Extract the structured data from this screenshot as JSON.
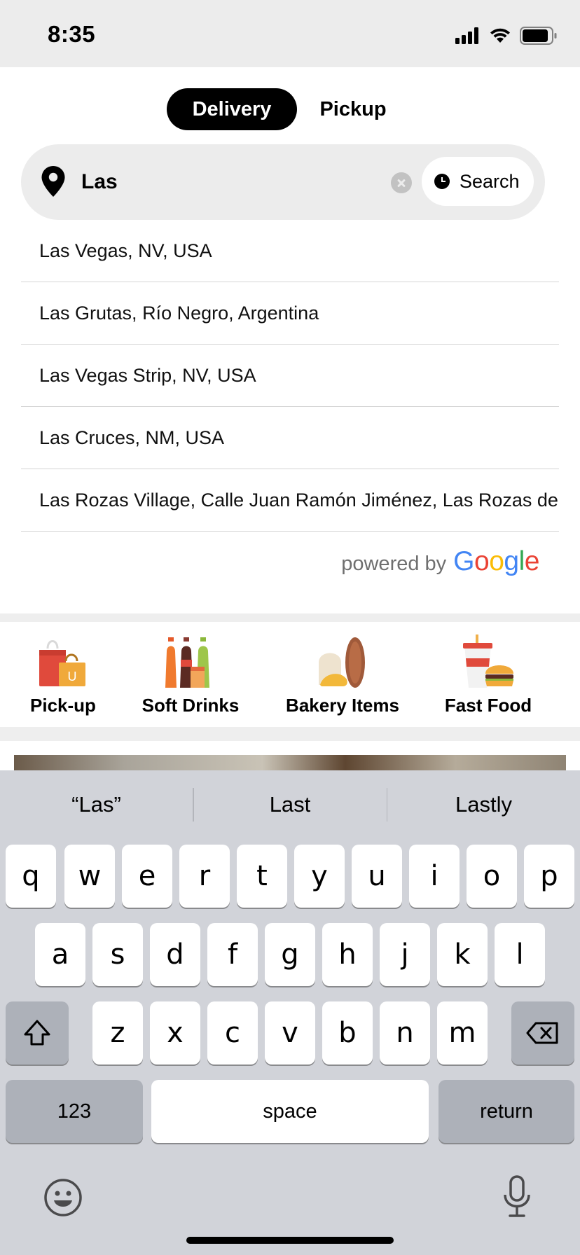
{
  "status_bar": {
    "time": "8:35",
    "icons": [
      "signal-icon",
      "wifi-icon",
      "battery-icon"
    ]
  },
  "mode_toggle": {
    "delivery_label": "Delivery",
    "pickup_label": "Pickup",
    "selected": "Delivery"
  },
  "search": {
    "value": "Las",
    "button_label": "Search",
    "icons": [
      "location-pin-icon",
      "clear-icon",
      "clock-icon"
    ]
  },
  "suggestions": [
    "Las Vegas, NV, USA",
    "Las Grutas, Río Negro, Argentina",
    "Las Vegas Strip, NV, USA",
    "Las Cruces, NM, USA",
    "Las Rozas Village, Calle Juan Ramón Jiménez, Las Rozas de Madrid, Spain"
  ],
  "attribution": {
    "powered_by": "powered by",
    "google": "Google",
    "google_colors": [
      "#4285F4",
      "#EA4335",
      "#FBBC05",
      "#4285F4",
      "#34A853",
      "#EA4335"
    ]
  },
  "categories": [
    {
      "label": "Pick-up",
      "icon": "shopping-bags-icon"
    },
    {
      "label": "Soft Drinks",
      "icon": "soda-bottles-icon"
    },
    {
      "label": "Bakery Items",
      "icon": "bread-icon"
    },
    {
      "label": "Fast Food",
      "icon": "burger-drink-icon"
    }
  ],
  "keyboard": {
    "predictions": [
      "“Las”",
      "Last",
      "Lastly"
    ],
    "row1": [
      "q",
      "w",
      "e",
      "r",
      "t",
      "y",
      "u",
      "i",
      "o",
      "p"
    ],
    "row2": [
      "a",
      "s",
      "d",
      "f",
      "g",
      "h",
      "j",
      "k",
      "l"
    ],
    "row3": [
      "z",
      "x",
      "c",
      "v",
      "b",
      "n",
      "m"
    ],
    "numbers_label": "123",
    "space_label": "space",
    "return_label": "return",
    "icons": [
      "shift-icon",
      "delete-icon",
      "emoji-icon",
      "microphone-icon"
    ]
  },
  "colors": {
    "accent": "#000000",
    "search_bg": "#ececec",
    "keyboard_bg": "#d1d3d9"
  }
}
